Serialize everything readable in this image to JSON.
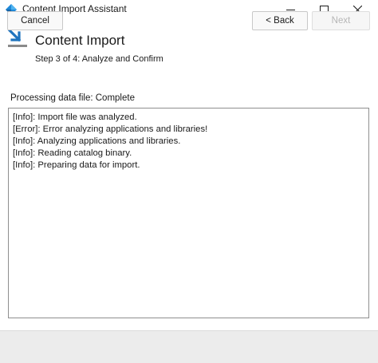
{
  "window": {
    "title": "Content Import Assistant",
    "controls": {
      "minimize": "minimize-icon",
      "maximize": "maximize-icon",
      "close": "close-icon"
    }
  },
  "header": {
    "icon": "import-arrow-icon",
    "title": "Content Import",
    "subtitle": "Step 3 of 4: Analyze and Confirm"
  },
  "main": {
    "status": "Processing data file: Complete",
    "log": [
      "[Info]: Import file was analyzed.",
      "[Error]: Error analyzing applications and libraries!",
      "[Info]: Analyzing applications and libraries.",
      "[Info]: Reading catalog binary.",
      "[Info]: Preparing data for import."
    ]
  },
  "footer": {
    "cancel_label": "Cancel",
    "back_label": "< Back",
    "next_label": "Next",
    "next_enabled": false
  },
  "colors": {
    "accent": "#1e73be",
    "footer_bg": "#ececec",
    "disabled_text": "#b6b6b6"
  }
}
